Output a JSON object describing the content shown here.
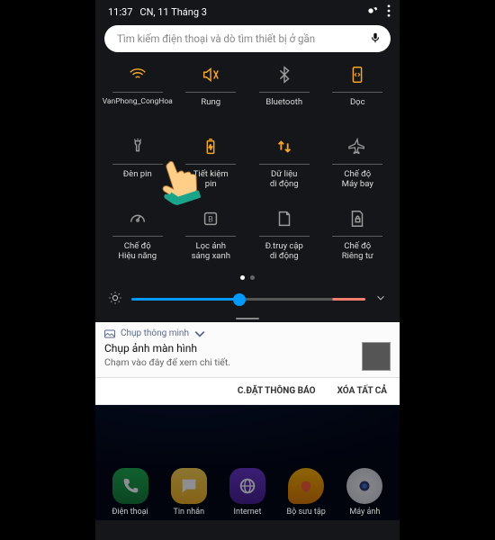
{
  "status": {
    "time": "11:37",
    "date": "CN, 11 Tháng 3"
  },
  "search": {
    "placeholder": "Tìm kiếm điện thoại và dò tìm thiết bị ở gần"
  },
  "tiles": [
    {
      "label": "VanPhong_CongHoa",
      "icon": "wifi",
      "on": true
    },
    {
      "label": "Rung",
      "icon": "vibrate",
      "on": true
    },
    {
      "label": "Bluetooth",
      "icon": "bluetooth",
      "on": false
    },
    {
      "label": "Dọc",
      "icon": "rotation-lock",
      "on": true
    },
    {
      "label": "Đèn pin",
      "icon": "flashlight",
      "on": false
    },
    {
      "label": "Tiết kiệm\npin",
      "icon": "battery-save",
      "on": true
    },
    {
      "label": "Dữ liệu\ndi động",
      "icon": "data",
      "on": true
    },
    {
      "label": "Chế độ\nMáy bay",
      "icon": "airplane",
      "on": false
    },
    {
      "label": "Chế độ\nHiệu năng",
      "icon": "performance",
      "on": false
    },
    {
      "label": "Lọc ánh\nsáng xanh",
      "icon": "bluelight",
      "on": false
    },
    {
      "label": "Đ.truy cập\ndi động",
      "icon": "hotspot",
      "on": false
    },
    {
      "label": "Chế độ\nRiêng tư",
      "icon": "private",
      "on": false
    }
  ],
  "brightness": {
    "percent": 46
  },
  "notification": {
    "app": "Chụp thông minh",
    "title": "Chụp ảnh màn hình",
    "subtitle": "Chạm vào đây để xem chi tiết."
  },
  "actions": {
    "settings": "C.ĐẶT THÔNG BÁO",
    "clear": "XÓA TẤT CẢ"
  },
  "dock": [
    {
      "label": "Điện thoại",
      "icon": "phone"
    },
    {
      "label": "Tin nhắn",
      "icon": "msg"
    },
    {
      "label": "Internet",
      "icon": "browser"
    },
    {
      "label": "Bộ sưu tập",
      "icon": "gallery"
    },
    {
      "label": "Máy ảnh",
      "icon": "camera"
    }
  ],
  "colors": {
    "accent": "#f5a623",
    "slider": "#0099ff"
  }
}
